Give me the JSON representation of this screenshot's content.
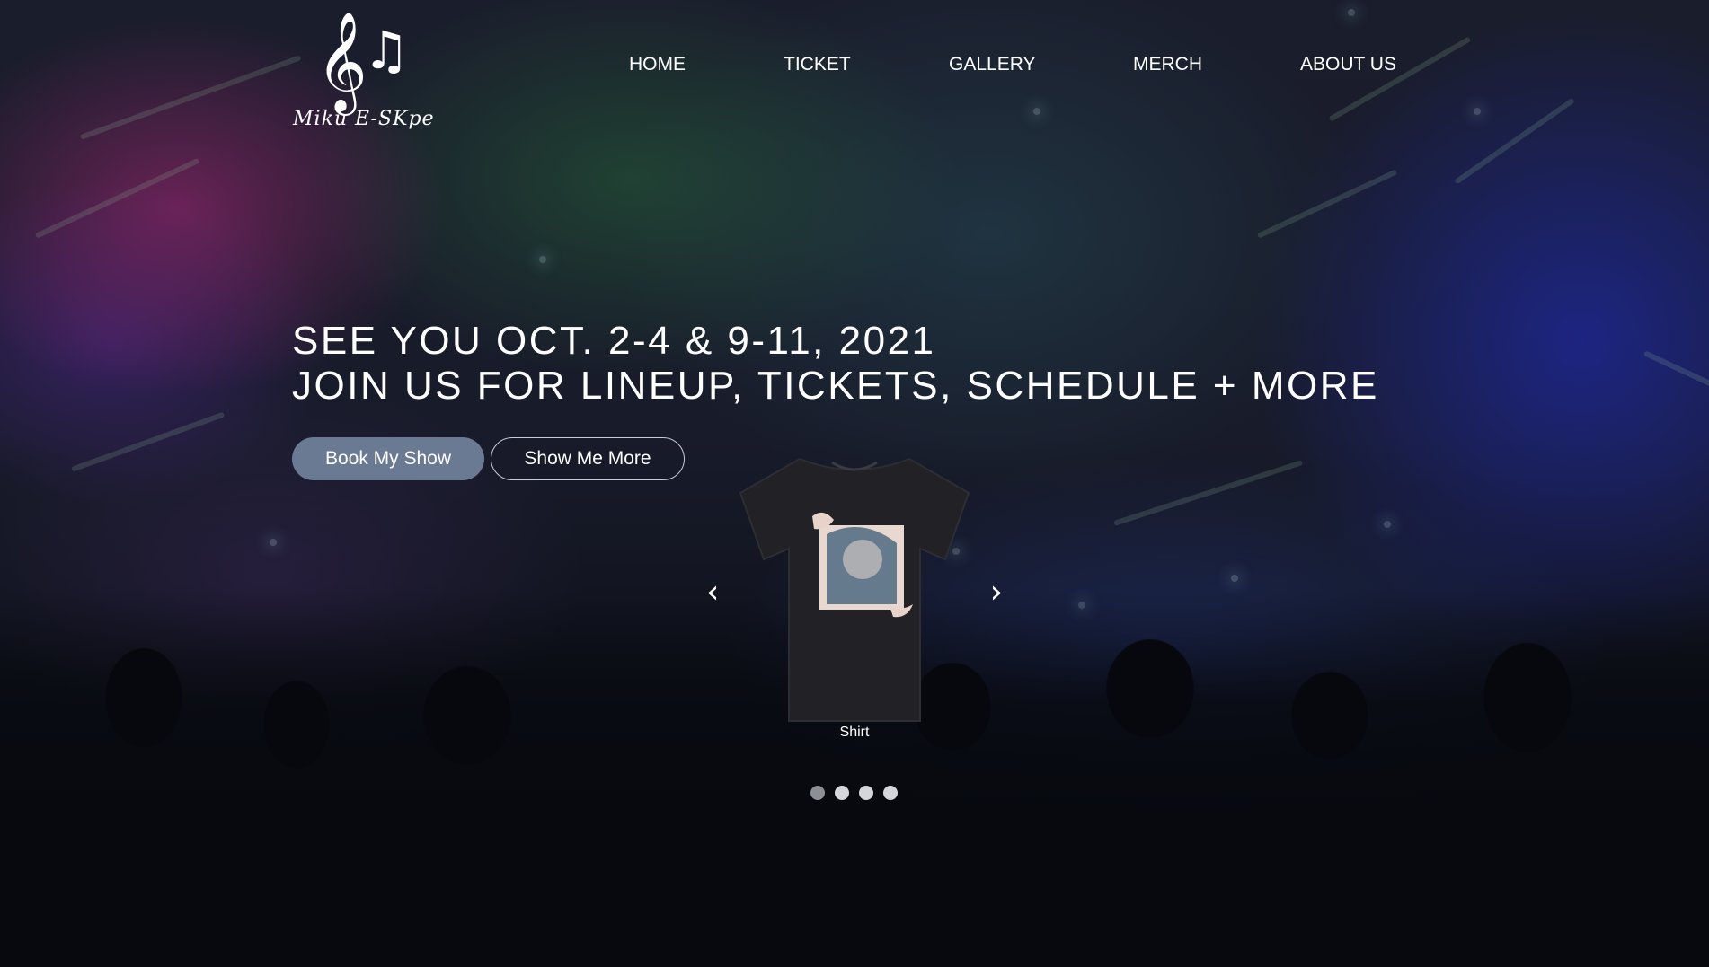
{
  "brand": {
    "logo_text": "Miku E-SKpe",
    "icon_name": "music-notes-icon"
  },
  "nav": {
    "items": [
      {
        "label": "HOME"
      },
      {
        "label": "TICKET"
      },
      {
        "label": "GALLERY"
      },
      {
        "label": "MERCH"
      },
      {
        "label": "ABOUT US"
      }
    ]
  },
  "hero": {
    "line1": "SEE YOU OCT. 2-4 & 9-11, 2021",
    "line2": "JOIN US FOR LINEUP, TICKETS, SCHEDULE + MORE",
    "primary_button": "Book My Show",
    "secondary_button": "Show Me More"
  },
  "carousel": {
    "caption": "Shirt",
    "prev_icon": "‹",
    "next_icon": "›",
    "slide_count": 4,
    "active_index": 0
  },
  "colors": {
    "primary_button": "#6b7a93",
    "text": "#ffffff"
  }
}
